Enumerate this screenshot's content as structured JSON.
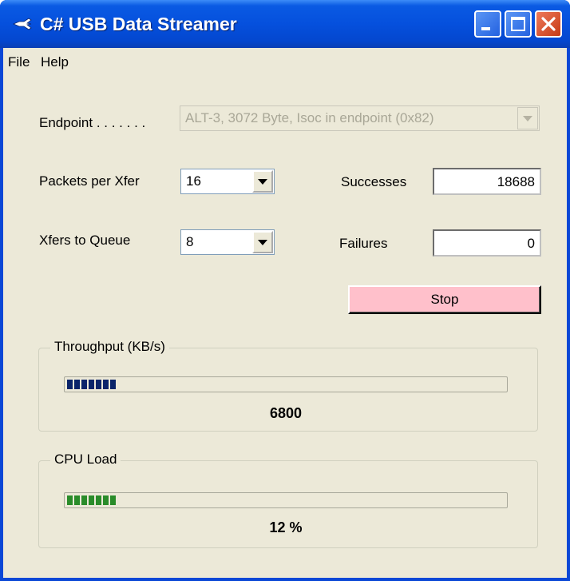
{
  "window": {
    "title": "C# USB Data Streamer",
    "icon": "usb-icon",
    "controls": [
      "minimize-icon",
      "maximize-icon",
      "close-icon"
    ]
  },
  "menu": [
    "File",
    "Help"
  ],
  "form": {
    "endpoint_label": "Endpoint . . . . . . .",
    "endpoint_value": "ALT-3, 3072 Byte, Isoc in endpoint (0x82)",
    "packets_label": "Packets per Xfer",
    "packets_value": "16",
    "xfers_label": "Xfers to Queue",
    "xfers_value": "8",
    "successes_label": "Successes",
    "successes_value": "18688",
    "failures_label": "Failures",
    "failures_value": "0",
    "stop_label": "Stop"
  },
  "throughput": {
    "label": "Throughput (KB/s)",
    "value": "6800",
    "fraction": 0.13,
    "color": "#0a246a"
  },
  "cpu": {
    "label": "CPU Load",
    "value": "12 %",
    "fraction": 0.12,
    "color": "#2a8c2a"
  },
  "colors": {
    "stop_button": "#ffc0cb",
    "titlebar": "#0550dd",
    "client_background": "#ece9d8"
  }
}
